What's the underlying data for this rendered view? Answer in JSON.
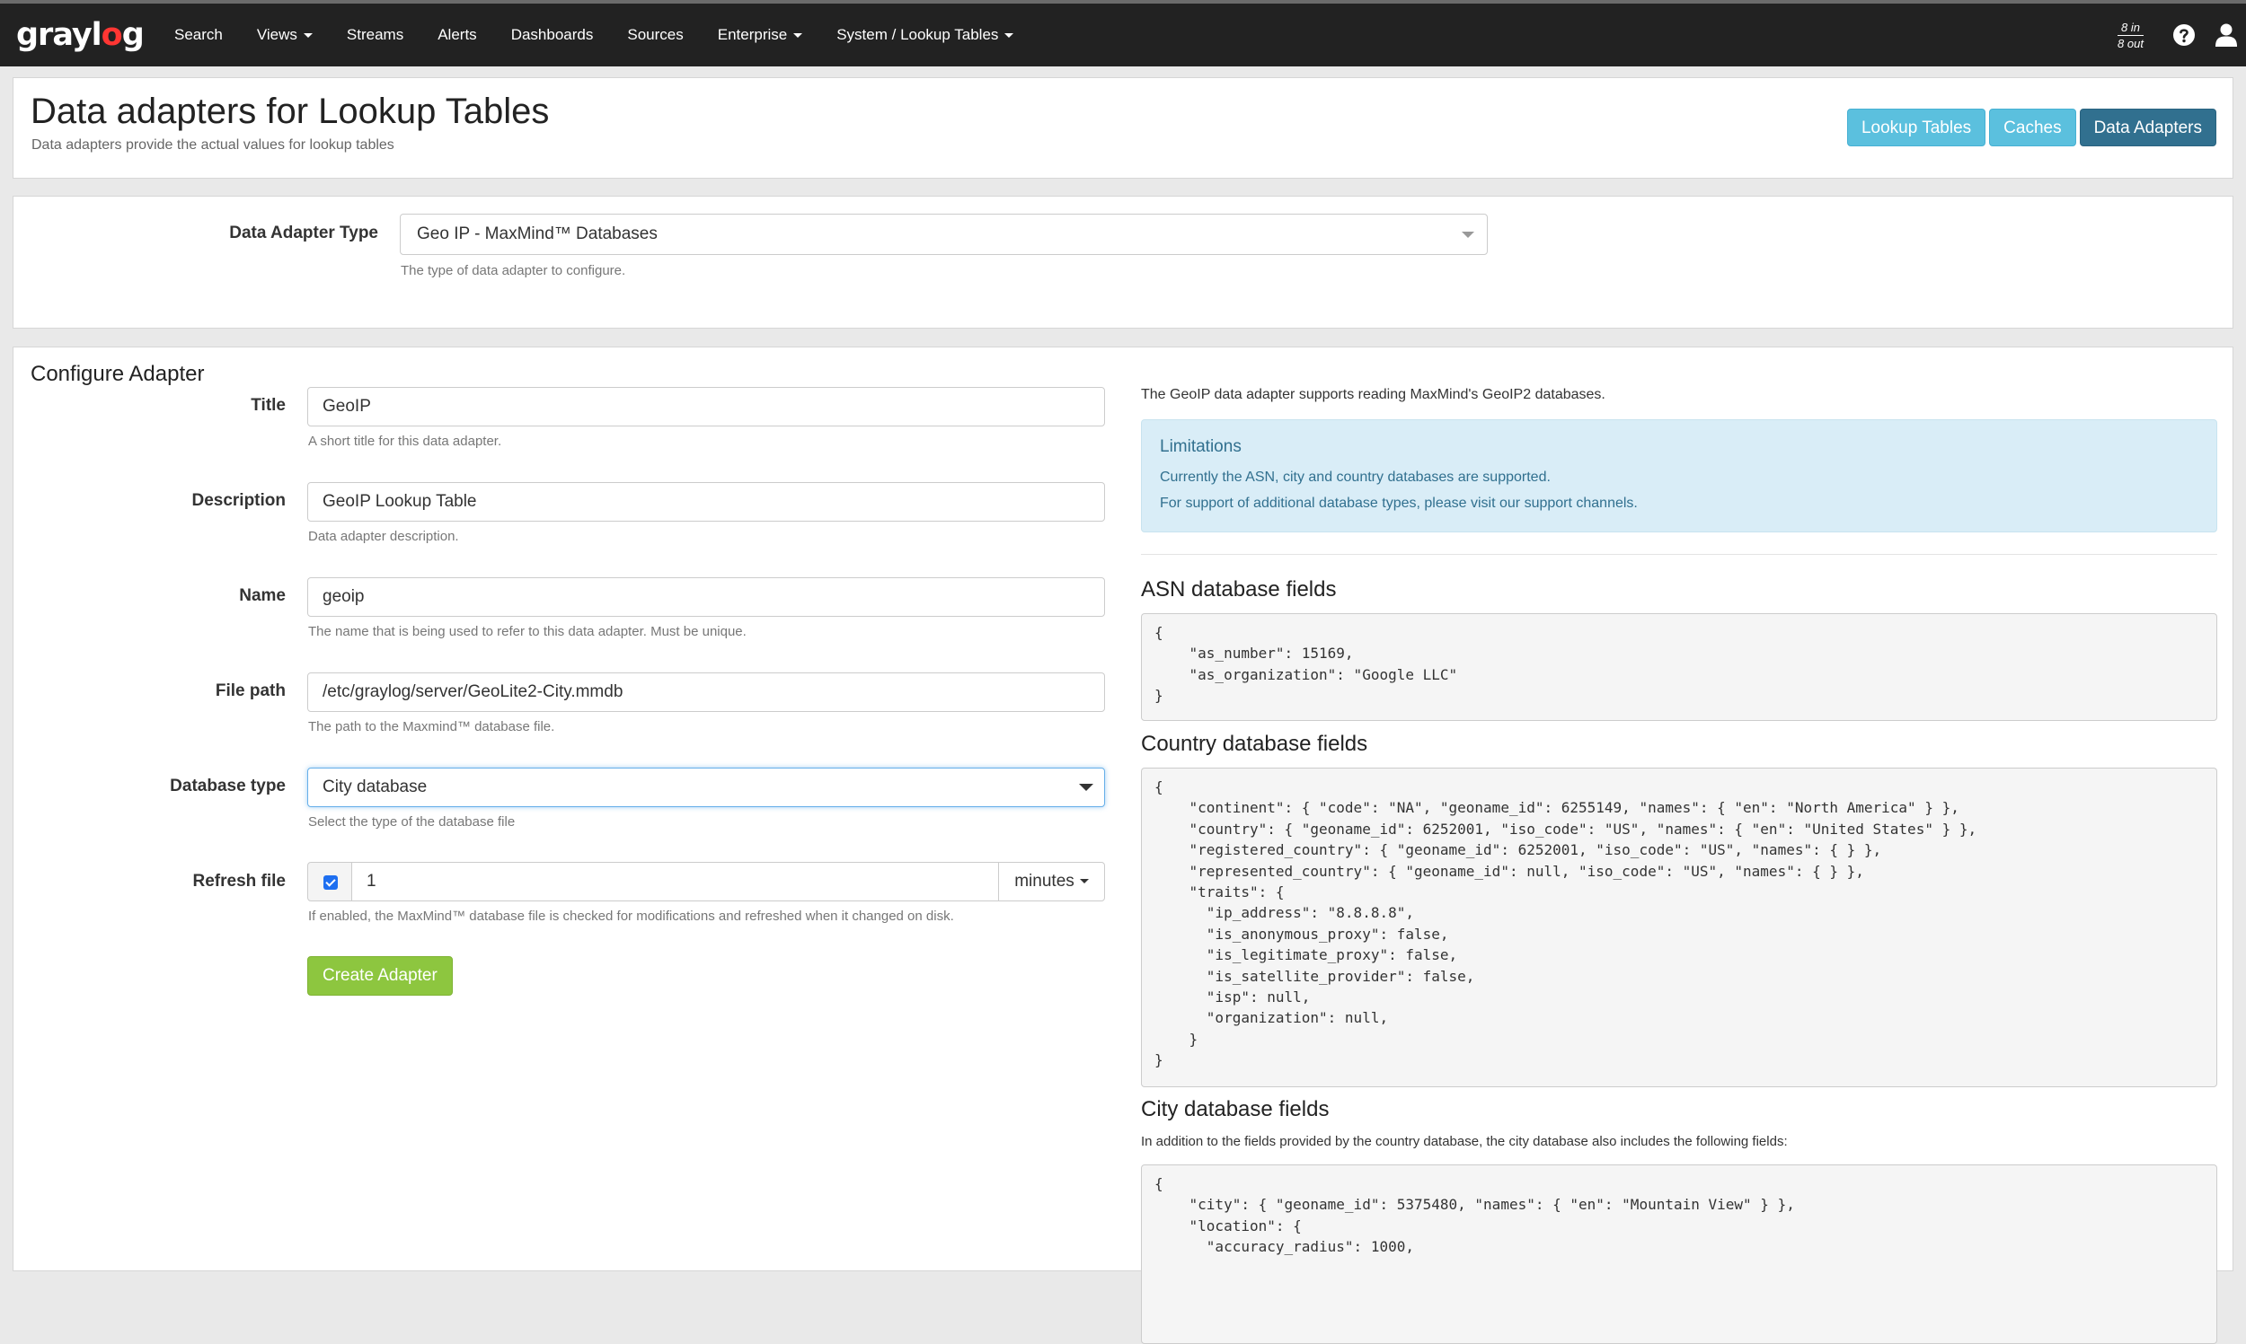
{
  "nav": {
    "brand": {
      "part1": "grayl",
      "part2": "o",
      "part3": "g"
    },
    "items": [
      {
        "label": "Search",
        "dropdown": false
      },
      {
        "label": "Views",
        "dropdown": true
      },
      {
        "label": "Streams",
        "dropdown": false
      },
      {
        "label": "Alerts",
        "dropdown": false
      },
      {
        "label": "Dashboards",
        "dropdown": false
      },
      {
        "label": "Sources",
        "dropdown": false
      },
      {
        "label": "Enterprise",
        "dropdown": true
      },
      {
        "label": "System / Lookup Tables",
        "dropdown": true
      }
    ],
    "throughput_in": "8 in",
    "throughput_out": "8 out"
  },
  "header": {
    "title": "Data adapters for Lookup Tables",
    "subtitle": "Data adapters provide the actual values for lookup tables",
    "buttons": {
      "lookup_tables": "Lookup Tables",
      "caches": "Caches",
      "data_adapters": "Data Adapters"
    }
  },
  "adapter_type": {
    "label": "Data Adapter Type",
    "value": "Geo IP - MaxMind™ Databases",
    "help": "The type of data adapter to configure."
  },
  "config": {
    "title": "Configure Adapter",
    "fields": {
      "title": {
        "label": "Title",
        "value": "GeoIP",
        "help": "A short title for this data adapter."
      },
      "description": {
        "label": "Description",
        "value": "GeoIP Lookup Table",
        "help": "Data adapter description."
      },
      "name": {
        "label": "Name",
        "value": "geoip",
        "help": "The name that is being used to refer to this data adapter. Must be unique."
      },
      "file_path": {
        "label": "File path",
        "value": "/etc/graylog/server/GeoLite2-City.mmdb",
        "help": "The path to the Maxmind™ database file."
      },
      "database_type": {
        "label": "Database type",
        "value": "City database",
        "help": "Select the type of the database file"
      },
      "refresh_file": {
        "label": "Refresh file",
        "checked": true,
        "value": "1",
        "unit": "minutes",
        "help": "If enabled, the MaxMind™ database file is checked for modifications and refreshed when it changed on disk."
      }
    },
    "submit_label": "Create Adapter"
  },
  "info": {
    "intro": "The GeoIP data adapter supports reading MaxMind's GeoIP2 databases.",
    "limitations": {
      "title": "Limitations",
      "line1": "Currently the ASN, city and country databases are supported.",
      "line2": "For support of additional database types, please visit our support channels."
    },
    "asn": {
      "title": "ASN database fields",
      "code": "{\n    \"as_number\": 15169,\n    \"as_organization\": \"Google LLC\"\n}"
    },
    "country": {
      "title": "Country database fields",
      "code": "{\n    \"continent\": { \"code\": \"NA\", \"geoname_id\": 6255149, \"names\": { \"en\": \"North America\" } },\n    \"country\": { \"geoname_id\": 6252001, \"iso_code\": \"US\", \"names\": { \"en\": \"United States\" } },\n    \"registered_country\": { \"geoname_id\": 6252001, \"iso_code\": \"US\", \"names\": { } },\n    \"represented_country\": { \"geoname_id\": null, \"iso_code\": \"US\", \"names\": { } },\n    \"traits\": {\n      \"ip_address\": \"8.8.8.8\",\n      \"is_anonymous_proxy\": false,\n      \"is_legitimate_proxy\": false,\n      \"is_satellite_provider\": false,\n      \"isp\": null,\n      \"organization\": null,\n    }\n}"
    },
    "city": {
      "title": "City database fields",
      "note": "In addition to the fields provided by the country database, the city database also includes the following fields:",
      "code": "{\n    \"city\": { \"geoname_id\": 5375480, \"names\": { \"en\": \"Mountain View\" } },\n    \"location\": {\n      \"accuracy_radius\": 1000,"
    }
  }
}
